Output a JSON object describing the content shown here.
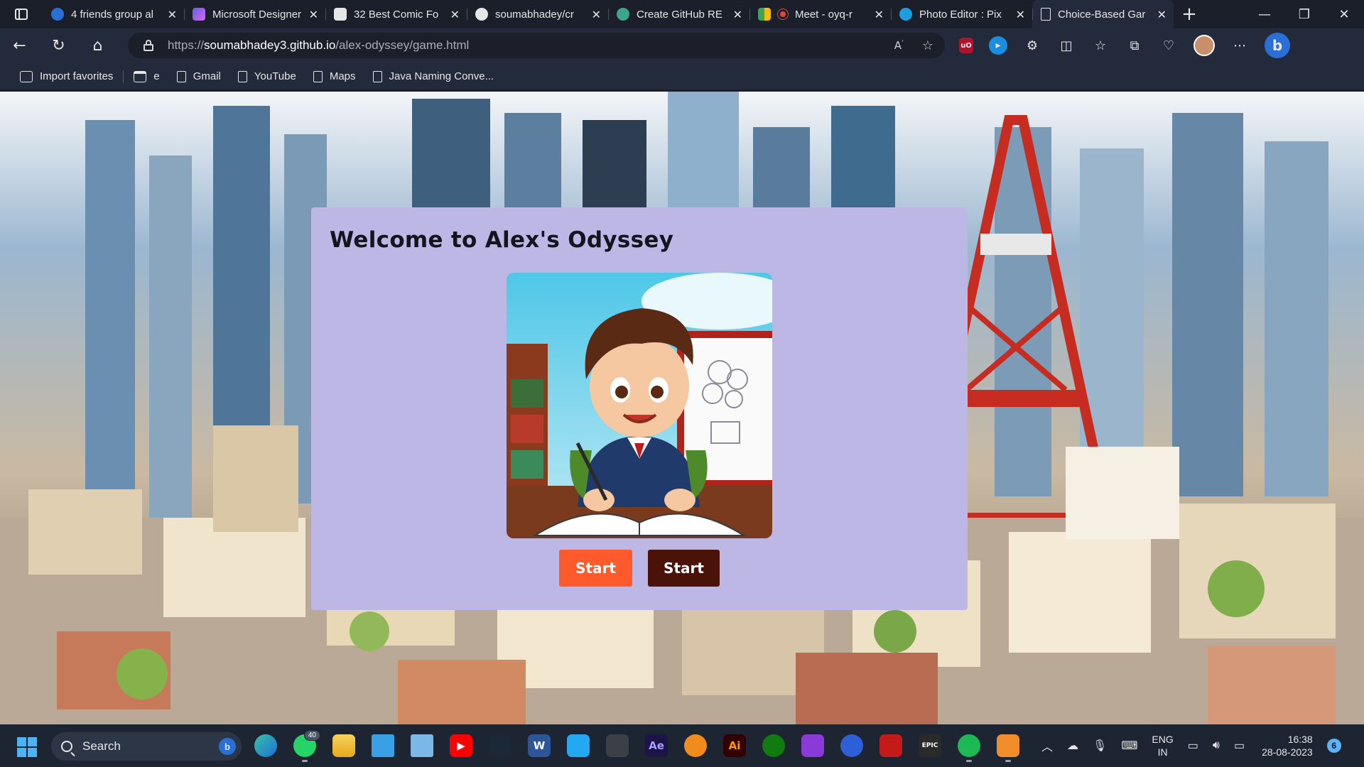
{
  "browser": {
    "tabs": [
      {
        "title": "4 friends group al",
        "favicon_color": "#2a6fd6",
        "icon": "bing-image-icon"
      },
      {
        "title": "Microsoft Designer",
        "favicon_color": "#9b59e6",
        "icon": "designer-icon"
      },
      {
        "title": "32 Best Comic Fo",
        "favicon_color": "#e6e6e6",
        "icon": "comic-icon"
      },
      {
        "title": "soumabhadey/cr",
        "favicon_color": "#e6e6e6",
        "icon": "github-icon"
      },
      {
        "title": "Create GitHub RE",
        "favicon_color": "#3da58a",
        "icon": "openai-icon"
      },
      {
        "title": "Meet - oyq-r",
        "favicon_color": "#e0453a",
        "icon": "meet-icon"
      },
      {
        "title": "Photo Editor : Pix",
        "favicon_color": "#1aa0e0",
        "icon": "pixlr-icon"
      },
      {
        "title": "Choice-Based Gar",
        "favicon_color": "#e6e6e6",
        "icon": "document-icon",
        "active": true
      }
    ],
    "url_scheme": "https://",
    "url_host": "soumabhadey3.github.io",
    "url_path": "/alex-odyssey/game.html",
    "favorites": [
      {
        "label": "Import favorites",
        "icon": "import-icon"
      },
      {
        "label": "e",
        "icon": "collection-icon"
      },
      {
        "label": "Gmail",
        "icon": "document-icon"
      },
      {
        "label": "YouTube",
        "icon": "document-icon"
      },
      {
        "label": "Maps",
        "icon": "document-icon"
      },
      {
        "label": "Java Naming Conve...",
        "icon": "document-icon"
      }
    ]
  },
  "page": {
    "heading": "Welcome to Alex's Odyssey",
    "image_subject": "cartoon boy with backpack drawing in a book",
    "buttons": [
      {
        "label": "Start",
        "color": "#fe5a2c"
      },
      {
        "label": "Start",
        "color": "#4a1208"
      }
    ],
    "card_color": "#bdb7e6"
  },
  "taskbar": {
    "search_placeholder": "Search",
    "apps": [
      {
        "name": "edge-icon",
        "label": "",
        "color": "#1c8ad6",
        "active": true
      },
      {
        "name": "whatsapp-icon",
        "label": "",
        "color": "#25d366",
        "badge": "40",
        "running": true
      },
      {
        "name": "file-explorer-icon",
        "label": "",
        "color": "#f5c33b"
      },
      {
        "name": "desktop-icon",
        "label": "",
        "color": "#3aa0e6"
      },
      {
        "name": "photos-icon",
        "label": "",
        "color": "#7bb8e8"
      },
      {
        "name": "youtube-icon",
        "label": "▶",
        "color": "#ff0000"
      },
      {
        "name": "steam-icon",
        "label": "",
        "color": "#1b2838"
      },
      {
        "name": "word-icon",
        "label": "W",
        "color": "#2b579a"
      },
      {
        "name": "vscode-icon",
        "label": "",
        "color": "#23a9f2"
      },
      {
        "name": "unity-icon",
        "label": "",
        "color": "#3b3f46"
      },
      {
        "name": "after-effects-icon",
        "label": "Ae",
        "color": "#1c1347"
      },
      {
        "name": "blender-icon",
        "label": "",
        "color": "#f08b1c"
      },
      {
        "name": "illustrator-icon",
        "label": "Ai",
        "color": "#330000"
      },
      {
        "name": "xbox-icon",
        "label": "",
        "color": "#107c10"
      },
      {
        "name": "app-purple-icon",
        "label": "",
        "color": "#8a3ad8"
      },
      {
        "name": "app-blue-icon",
        "label": "",
        "color": "#2d5fd6"
      },
      {
        "name": "app-red-icon",
        "label": "",
        "color": "#c41a1a"
      },
      {
        "name": "epic-games-icon",
        "label": "EPIC",
        "color": "#2a2a2a"
      },
      {
        "name": "spotify-icon",
        "label": "",
        "color": "#1db954",
        "running": true
      },
      {
        "name": "media-player-icon",
        "label": "",
        "color": "#f08c2a",
        "running": true
      }
    ],
    "language_top": "ENG",
    "language_bottom": "IN",
    "time": "16:38",
    "date": "28-08-2023",
    "notification_count": "6"
  }
}
